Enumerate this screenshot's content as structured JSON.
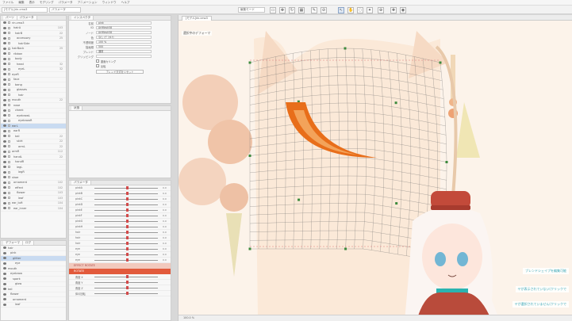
{
  "menubar": [
    "ファイル",
    "編集",
    "表示",
    "モデリング",
    "パラメータ",
    "アニメーション",
    "ウィンドウ",
    "ヘルプ"
  ],
  "toolbar": {
    "file_field": "[モデル]rin.cmo3",
    "search_field": "パラメータ",
    "mode_field": "編集モード",
    "icons": [
      "select-icon",
      "move-icon",
      "rotate-icon",
      "mesh-icon",
      "brush-icon",
      "eyedropper-icon",
      "hand-icon",
      "zoom-icon"
    ]
  },
  "parts_panel": {
    "tab": "パーツ",
    "header": "パラメータ",
    "rows": [
      {
        "name": "rin.cmo3",
        "num": ""
      },
      {
        "name": "hairA",
        "num": "103"
      },
      {
        "name": "hairB",
        "num": "22"
      },
      {
        "name": "accessory",
        "num": "25"
      },
      {
        "name": "hairSide",
        "num": ""
      },
      {
        "name": "hairBack",
        "num": "25"
      },
      {
        "name": "ribbon",
        "num": ""
      },
      {
        "name": "body",
        "num": ""
      },
      {
        "name": "head",
        "num": "32"
      },
      {
        "name": "eyeL",
        "num": "32"
      },
      {
        "name": "eyeR",
        "num": ""
      },
      {
        "name": "face",
        "num": ""
      },
      {
        "name": "bang",
        "num": ""
      },
      {
        "name": "glasses",
        "num": ""
      },
      {
        "name": "hair",
        "num": ""
      },
      {
        "name": "mouth",
        "num": "22"
      },
      {
        "name": "nose",
        "num": ""
      },
      {
        "name": "cheek",
        "num": ""
      },
      {
        "name": "eyebrowL",
        "num": ""
      },
      {
        "name": "eyebrowR",
        "num": ""
      },
      {
        "name": "earL",
        "num": ""
      },
      {
        "name": "earR",
        "num": ""
      },
      {
        "name": "tail",
        "num": "22"
      },
      {
        "name": "skirt",
        "num": "22"
      },
      {
        "name": "armL",
        "num": "22"
      },
      {
        "name": "armR",
        "num": "112"
      },
      {
        "name": "handL",
        "num": "22"
      },
      {
        "name": "handR",
        "num": ""
      },
      {
        "name": "legL",
        "num": ""
      },
      {
        "name": "legR",
        "num": ""
      },
      {
        "name": "shoe",
        "num": ""
      },
      {
        "name": "ornament",
        "num": "102"
      },
      {
        "name": "effect",
        "num": "102"
      },
      {
        "name": "flower",
        "num": "103"
      },
      {
        "name": "leaf",
        "num": "103"
      },
      {
        "name": "ear_tuft",
        "num": "104"
      },
      {
        "name": "ear_inner",
        "num": "104"
      }
    ]
  },
  "deformer_panel": {
    "tabs": [
      "デフォーマ",
      "ログ"
    ],
    "rows": [
      "hair",
      "pink",
      "glitter",
      "eye",
      "mouth",
      "eyebrow",
      "spark",
      "glow",
      "tail",
      "flower",
      "ornament",
      "leaf"
    ]
  },
  "inspector": {
    "tab": "インスペクタ",
    "lines": [
      {
        "label": "名前",
        "value": "pink"
      },
      {
        "label": "ID",
        "value": "ArtMesh58"
      },
      {
        "label": "ノード",
        "value": "ArtMesh58"
      },
      {
        "label": "色",
        "value": "なし (ﾃﾞﾌｫﾙﾄ)"
      },
      {
        "label": "不透明度",
        "value": "100 %"
      },
      {
        "label": "描画順",
        "value": "500"
      },
      {
        "label": "ブレンド",
        "value": "通常"
      },
      {
        "label": "クリッピング",
        "value": ""
      }
    ],
    "checkbox_1": "裏面カリング",
    "checkbox_2": "反転",
    "button": "ブレンド方式をリセット",
    "sub_tab": "状態"
  },
  "parameter_panel": {
    "tab": "パラメータ",
    "rows": [
      {
        "name": "pinkA",
        "value": "0.0",
        "pos": 0.5
      },
      {
        "name": "pinkB",
        "value": "0.0",
        "pos": 0.5
      },
      {
        "name": "pinkC",
        "value": "0.0",
        "pos": 0.5
      },
      {
        "name": "pinkD",
        "value": "0.0",
        "pos": 0.5
      },
      {
        "name": "pinkE",
        "value": "0.0",
        "pos": 0.5
      },
      {
        "name": "pinkF",
        "value": "0.0",
        "pos": 0.5
      },
      {
        "name": "pinkG",
        "value": "0.0",
        "pos": 0.5
      },
      {
        "name": "pinkH",
        "value": "0.0",
        "pos": 0.5
      },
      {
        "name": "hair",
        "value": "0.0",
        "pos": 0.5
      },
      {
        "name": "hair",
        "value": "0.0",
        "pos": 0.5
      },
      {
        "name": "hair",
        "value": "0.0",
        "pos": 0.5
      },
      {
        "name": "eye",
        "value": "0.0",
        "pos": 0.5
      },
      {
        "name": "eye",
        "value": "0.0",
        "pos": 0.5
      },
      {
        "name": "eye",
        "value": "0.0",
        "pos": 0.5
      }
    ],
    "group_1": "EFFECT ROTATE",
    "group_2": "ROTATE",
    "extra_rows": [
      "角度 X",
      "角度 Y",
      "角度 Z",
      "体の回転"
    ]
  },
  "bottom_panel": {
    "tabs": [
      "デフォーマ",
      "ログ"
    ],
    "rows": [
      "hair",
      "pink",
      "glitter"
    ]
  },
  "viewport": {
    "tab": "[モデル]rin.cmo3",
    "label": "選択中のデフォーマ",
    "zoom": "100.0 %",
    "colors": {
      "bg": "#fcf3ea",
      "grid": "#6a6a6a",
      "accent": "#e86e1a"
    }
  },
  "chat": [
    "ブレンドシェイプを編集可能",
    "ヤが表示されていない(クリックで",
    "ヤが選択されていません(クリックで"
  ]
}
